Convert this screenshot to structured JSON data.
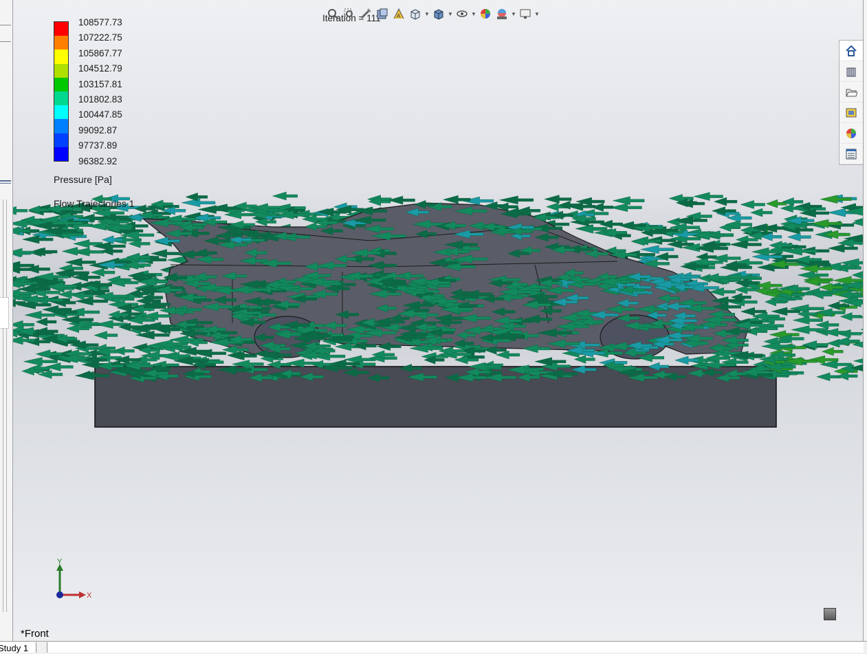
{
  "window": {
    "iteration_label": "Iteration = 111",
    "view_name": "*Front",
    "study_tab": "Study 1"
  },
  "legend": {
    "values": [
      "108577.73",
      "107222.75",
      "105867.77",
      "104512.79",
      "103157.81",
      "101802.83",
      "100447.85",
      "99092.87",
      "97737.89",
      "96382.92"
    ],
    "colors": [
      "#ff0000",
      "#ff7f00",
      "#ffff00",
      "#b0e000",
      "#00c800",
      "#00d890",
      "#00ffff",
      "#0080ff",
      "#0040ff",
      "#0000ff"
    ],
    "unit_label": "Pressure [Pa]",
    "plot_name": "Flow Trajectories 1"
  },
  "heads_up_toolbar": [
    {
      "icon": "zoom-to-fit-icon"
    },
    {
      "icon": "zoom-area-icon"
    },
    {
      "icon": "previous-view-icon"
    },
    {
      "icon": "section-view-icon"
    },
    {
      "icon": "dynamic-annotation-icon"
    },
    {
      "icon": "view-orientation-icon"
    },
    {
      "icon": "display-style-icon"
    },
    {
      "icon": "hide-show-items-icon"
    },
    {
      "icon": "edit-appearance-icon"
    },
    {
      "icon": "apply-scene-icon"
    },
    {
      "icon": "view-settings-icon"
    }
  ],
  "task_pane": [
    {
      "icon": "home-icon"
    },
    {
      "icon": "design-library-icon"
    },
    {
      "icon": "file-explorer-icon"
    },
    {
      "icon": "view-palette-icon"
    },
    {
      "icon": "appearances-icon"
    },
    {
      "icon": "custom-properties-icon"
    }
  ],
  "axes": {
    "y_label": "Y",
    "x_label": "X"
  },
  "colors": {
    "arrow_green": "#138a5e",
    "arrow_dark": "#0c6b47",
    "arrow_teal": "#1a9aa6",
    "body": "#5a5d68",
    "base": "#484a54"
  }
}
